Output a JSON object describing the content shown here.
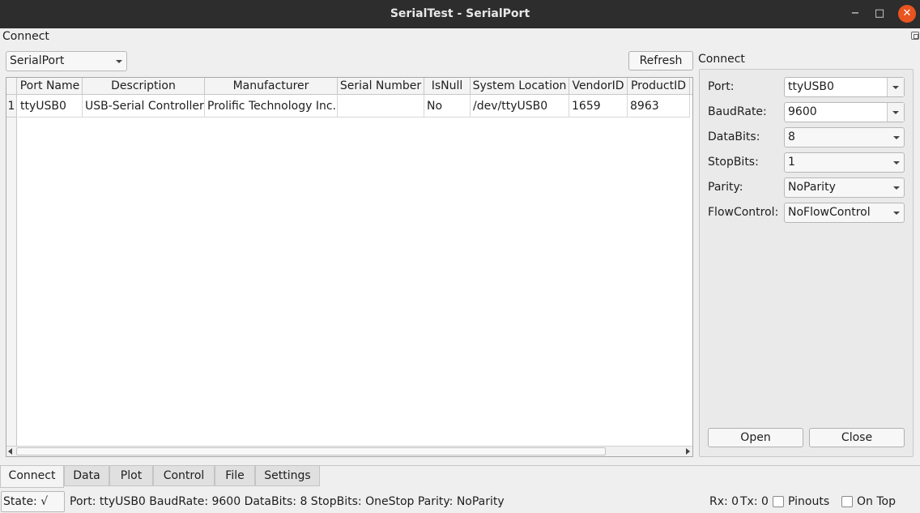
{
  "window": {
    "title": "SerialTest - SerialPort",
    "minimize_glyph": "−",
    "maximize_glyph": "□",
    "close_glyph": "✕"
  },
  "dock": {
    "title": "Connect"
  },
  "port_type": {
    "selected": "SerialPort"
  },
  "refresh_label": "Refresh",
  "table": {
    "headers": [
      "Port Name",
      "Description",
      "Manufacturer",
      "Serial Number",
      "IsNull",
      "System Location",
      "VendorID",
      "ProductID"
    ],
    "rows": [
      {
        "num": "1",
        "cells": [
          "ttyUSB0",
          "USB-Serial Controller",
          "Prolific Technology Inc.",
          "",
          "No",
          "/dev/ttyUSB0",
          "1659",
          "8963"
        ]
      }
    ]
  },
  "connect_group": {
    "title": "Connect",
    "fields": [
      {
        "label": "Port:",
        "value": "ttyUSB0"
      },
      {
        "label": "BaudRate:",
        "value": "9600"
      },
      {
        "label": "DataBits:",
        "value": "8"
      },
      {
        "label": "StopBits:",
        "value": "1"
      },
      {
        "label": "Parity:",
        "value": "NoParity"
      },
      {
        "label": "FlowControl:",
        "value": "NoFlowControl"
      }
    ],
    "open_label": "Open",
    "close_label": "Close"
  },
  "tabs": [
    {
      "label": "Connect",
      "active": true
    },
    {
      "label": "Data"
    },
    {
      "label": "Plot"
    },
    {
      "label": "Control"
    },
    {
      "label": "File"
    },
    {
      "label": "Settings"
    }
  ],
  "status": {
    "state": "State: √",
    "info": "Port: ttyUSB0 BaudRate: 9600 DataBits: 8 StopBits: OneStop Parity: NoParity",
    "rx": "Rx: 0",
    "tx": "Tx: 0",
    "pinouts_label": "Pinouts",
    "ontop_label": "On Top"
  },
  "colors": {
    "titlebar": "#2d2d2d",
    "close_button": "#e95420",
    "background": "#efefef"
  }
}
